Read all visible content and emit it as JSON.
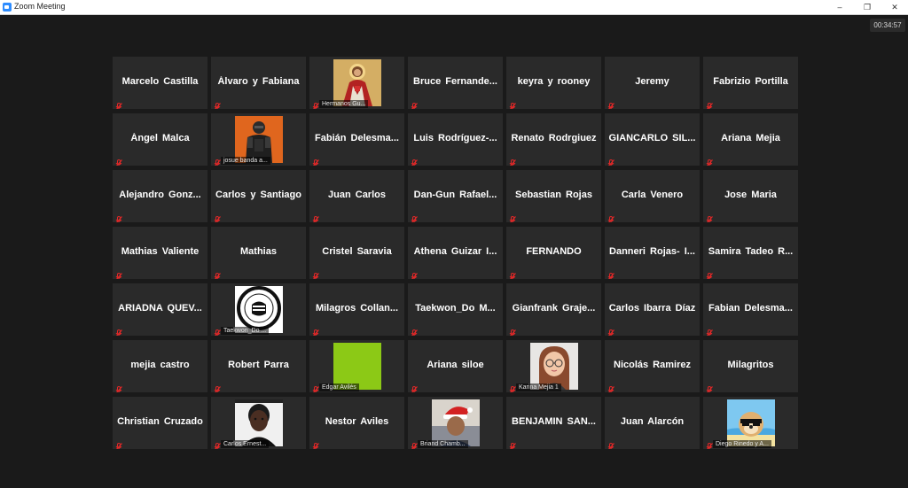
{
  "window": {
    "title": "Zoom Meeting",
    "min": "–",
    "max": "❐",
    "close": "✕"
  },
  "meeting": {
    "timer": "00:34:57"
  },
  "participants": [
    {
      "name": "Marcelo Castilla"
    },
    {
      "name": "Álvaro y Fabiana"
    },
    {
      "name": "Hermanos Gu...",
      "video": "jesus-portrait"
    },
    {
      "name": "Bruce Fernande..."
    },
    {
      "name": "keyra y rooney"
    },
    {
      "name": "Jeremy"
    },
    {
      "name": "Fabrizio Portilla"
    },
    {
      "name": "Ángel Malca"
    },
    {
      "name": "josue banda a...",
      "video": "armored-character"
    },
    {
      "name": "Fabián Delesma..."
    },
    {
      "name": "Luis Rodríguez-..."
    },
    {
      "name": "Renato Rodrgiuez"
    },
    {
      "name": "GIANCARLO SIL..."
    },
    {
      "name": "Ariana Mejia"
    },
    {
      "name": "Alejandro Gonz..."
    },
    {
      "name": "Carlos y Santiago"
    },
    {
      "name": "Juan Carlos"
    },
    {
      "name": "Dan-Gun Rafael..."
    },
    {
      "name": "Sebastian Rojas"
    },
    {
      "name": "Carla Venero"
    },
    {
      "name": "Jose Maria"
    },
    {
      "name": "Mathias Valiente"
    },
    {
      "name": "Mathias"
    },
    {
      "name": "Cristel Saravia"
    },
    {
      "name": "Athena Guizar I..."
    },
    {
      "name": "FERNANDO"
    },
    {
      "name": "Danneri Rojas- I..."
    },
    {
      "name": "Samira Tadeo R..."
    },
    {
      "name": "ARIADNA QUEV..."
    },
    {
      "name": "Taekwon_Do ...",
      "video": "taekwondo-logo",
      "logo_text": "MU-SHIN TAEKWON-DO"
    },
    {
      "name": "Milagros Collan..."
    },
    {
      "name": "Taekwon_Do M..."
    },
    {
      "name": "Gianfrank Graje..."
    },
    {
      "name": "Carlos Ibarra Díaz"
    },
    {
      "name": "Fabian Delesma..."
    },
    {
      "name": "mejia castro"
    },
    {
      "name": "Robert Parra"
    },
    {
      "name": "Edgar Avilés",
      "video": "green-square"
    },
    {
      "name": "Ariana siloe"
    },
    {
      "name": "Karina Mejia 1",
      "video": "cartoon-avatar"
    },
    {
      "name": "Nicolás Ramirez"
    },
    {
      "name": "Milagritos"
    },
    {
      "name": "Christian Cruzado"
    },
    {
      "name": "Carlos Ernest...",
      "video": "boy-photo"
    },
    {
      "name": "Nestor Aviles"
    },
    {
      "name": "Briand Chamb...",
      "video": "santa-hat-photo"
    },
    {
      "name": "BENJAMIN SAN..."
    },
    {
      "name": "Juan Alarcón"
    },
    {
      "name": "Diego Rinedo y A...",
      "video": "doge-meme"
    }
  ],
  "icons": {
    "muted": "muted-mic-icon"
  },
  "colors": {
    "background": "#1a1a1a",
    "tile": "#2a2a2a",
    "muted": "#e02828"
  }
}
